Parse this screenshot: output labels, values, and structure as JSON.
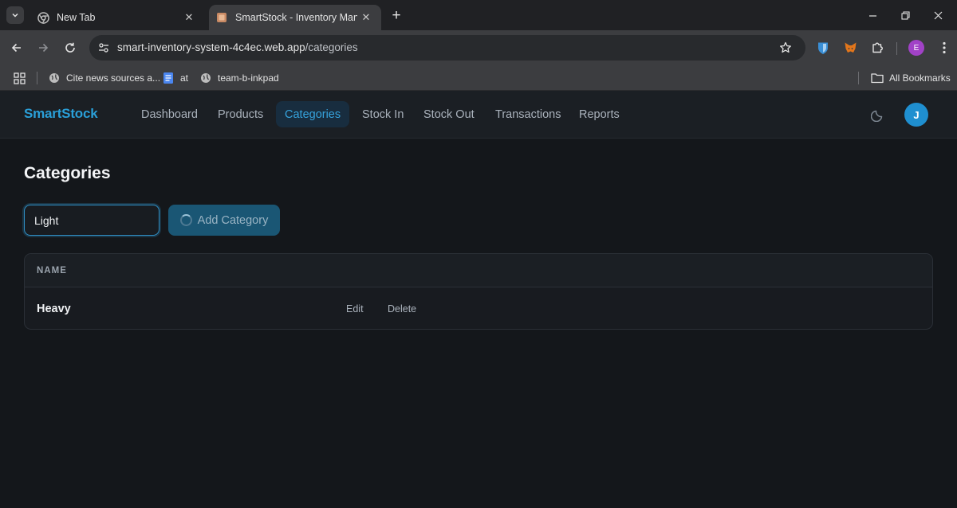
{
  "browser": {
    "tabs": [
      {
        "title": "New Tab",
        "active": false,
        "icon": "chrome-icon"
      },
      {
        "title": "SmartStock - Inventory Management",
        "active": true,
        "icon": "box-icon"
      }
    ],
    "address": {
      "host": "smart-inventory-system-4c4ec.web.app",
      "path": "/categories"
    },
    "bookmarks": [
      {
        "label": "Cite news sources a...",
        "icon": "globe-icon"
      },
      {
        "label": "at",
        "icon": "docs-icon"
      },
      {
        "label": "team-b-inkpad",
        "icon": "globe-icon"
      }
    ],
    "all_bookmarks_label": "All Bookmarks",
    "profile_initial": "E"
  },
  "app": {
    "brand": "SmartStock",
    "nav": [
      {
        "label": "Dashboard",
        "active": false
      },
      {
        "label": "Products",
        "active": false
      },
      {
        "label": "Categories",
        "active": true
      },
      {
        "label": "Stock In",
        "active": false
      },
      {
        "label": "Stock Out",
        "active": false
      },
      {
        "label": "Transactions",
        "active": false
      },
      {
        "label": "Reports",
        "active": false
      }
    ],
    "user_initial": "J",
    "accent_color": "#2a9fd8"
  },
  "page": {
    "title": "Categories",
    "category_input_value": "Light",
    "add_button_label": "Add Category",
    "add_button_loading": true,
    "table": {
      "columns": [
        "NAME"
      ],
      "rows": [
        {
          "name": "Heavy",
          "edit_label": "Edit",
          "delete_label": "Delete"
        }
      ]
    }
  }
}
